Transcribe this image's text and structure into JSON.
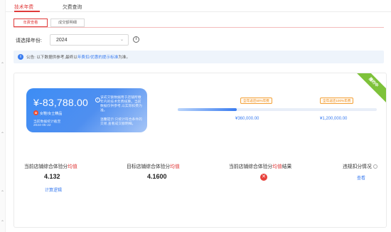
{
  "main_tabs": [
    {
      "label": "技术年费"
    },
    {
      "label": "欠费查询"
    }
  ],
  "sub_tabs": [
    {
      "label": "年费查看"
    },
    {
      "label": "成交额明细"
    }
  ],
  "year_filter": {
    "label": "请选择年份:",
    "value": "2024"
  },
  "notice": {
    "prefix": "公告:",
    "text_before": "以下数据供参考,最终以",
    "highlight": "年费扣/优惠的提示标准",
    "text_after": "为准。"
  },
  "ribbon": "履约中",
  "summary": {
    "amount": "¥-83,788.00",
    "description": "该成交额数据用于店铺所缴年内的技术年费核算。当前数据仅供参考,以实际扣费为准。",
    "store_name": "女鞋/女士精品",
    "stat_label": "当前数据统计截至",
    "stat_date": "2024-05-22",
    "tip": "温馨提示:只统计符合条件的交易,查看成交额明细。"
  },
  "progress": {
    "fraction": 0.295,
    "milestones": [
      {
        "tag": "全年返还50%年费",
        "value": "¥360,000.00"
      },
      {
        "tag": "全年返还100%年费",
        "value": "¥1,200,000.00"
      }
    ]
  },
  "metrics": [
    {
      "label_pre": "当前店铺综合体验分",
      "label_red": "均值",
      "label_post": "",
      "value": "4.132",
      "link": "计算逻辑"
    },
    {
      "label_pre": "目标店铺综合体验分",
      "label_red": "均值",
      "label_post": "",
      "value": "4.1600"
    },
    {
      "label_pre": "当前店铺综合体验分",
      "label_red": "均值",
      "label_post": "结果",
      "status": "fail"
    },
    {
      "label_pre": "违规扣分情况",
      "label_red": "",
      "label_post": "",
      "link": "查看"
    }
  ],
  "colors": {
    "accent_red": "#e03b3b",
    "link_blue": "#3a7cf0",
    "ribbon_green": "#7ec23a",
    "milestone_orange": "#f08c1a"
  },
  "icons": {
    "info": "info-circle-icon",
    "fail": "close-circle-icon",
    "chevron": "chevron-down-icon"
  }
}
